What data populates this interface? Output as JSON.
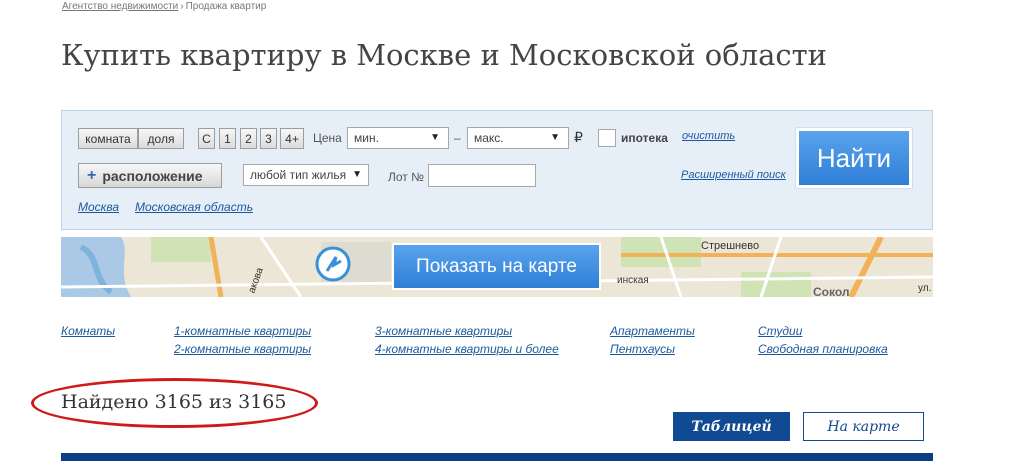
{
  "breadcrumb": {
    "home": "Агентство недвижимости",
    "sep": "›",
    "current": "Продажа квартир"
  },
  "title": "Купить квартиру в Москве и Московской области",
  "search": {
    "room_btn": "комната",
    "share_btn": "доля",
    "room_counts": [
      "С",
      "1",
      "2",
      "3",
      "4+"
    ],
    "price_label": "Цена",
    "price_min": "мин.",
    "price_dash": "–",
    "price_max": "макс.",
    "currency": "₽",
    "mortgage_label": "ипотека",
    "clear_link": "очистить",
    "location_btn": "расположение",
    "location_plus": "+",
    "housing_type": "любой тип жилья",
    "lot_label": "Лот №",
    "advanced_link": "Расширенный поиск",
    "find_btn": "Найти",
    "region_moscow": "Москва",
    "region_oblast": "Московская область"
  },
  "map": {
    "show_btn": "Показать на карте",
    "labels": [
      "Стрешнево",
      "инская",
      "Сокол",
      "акова",
      "ул."
    ]
  },
  "categories": {
    "col1": [
      "Комнаты"
    ],
    "col2": [
      "1-комнатные квартиры",
      "2-комнатные квартиры"
    ],
    "col3": [
      "3-комнатные квартиры",
      "4-комнатные квартиры и более"
    ],
    "col4": [
      "Апартаменты",
      "Пентхаусы"
    ],
    "col5": [
      "Студии",
      "Свободная планировка"
    ]
  },
  "results": {
    "found": "Найдено 3165 из 3165"
  },
  "view_tabs": {
    "table": "Таблицей",
    "map": "На карте"
  },
  "colors": {
    "accent": "#2f7fd6",
    "dark_blue": "#0f4a92",
    "highlight": "#d01a1a"
  }
}
